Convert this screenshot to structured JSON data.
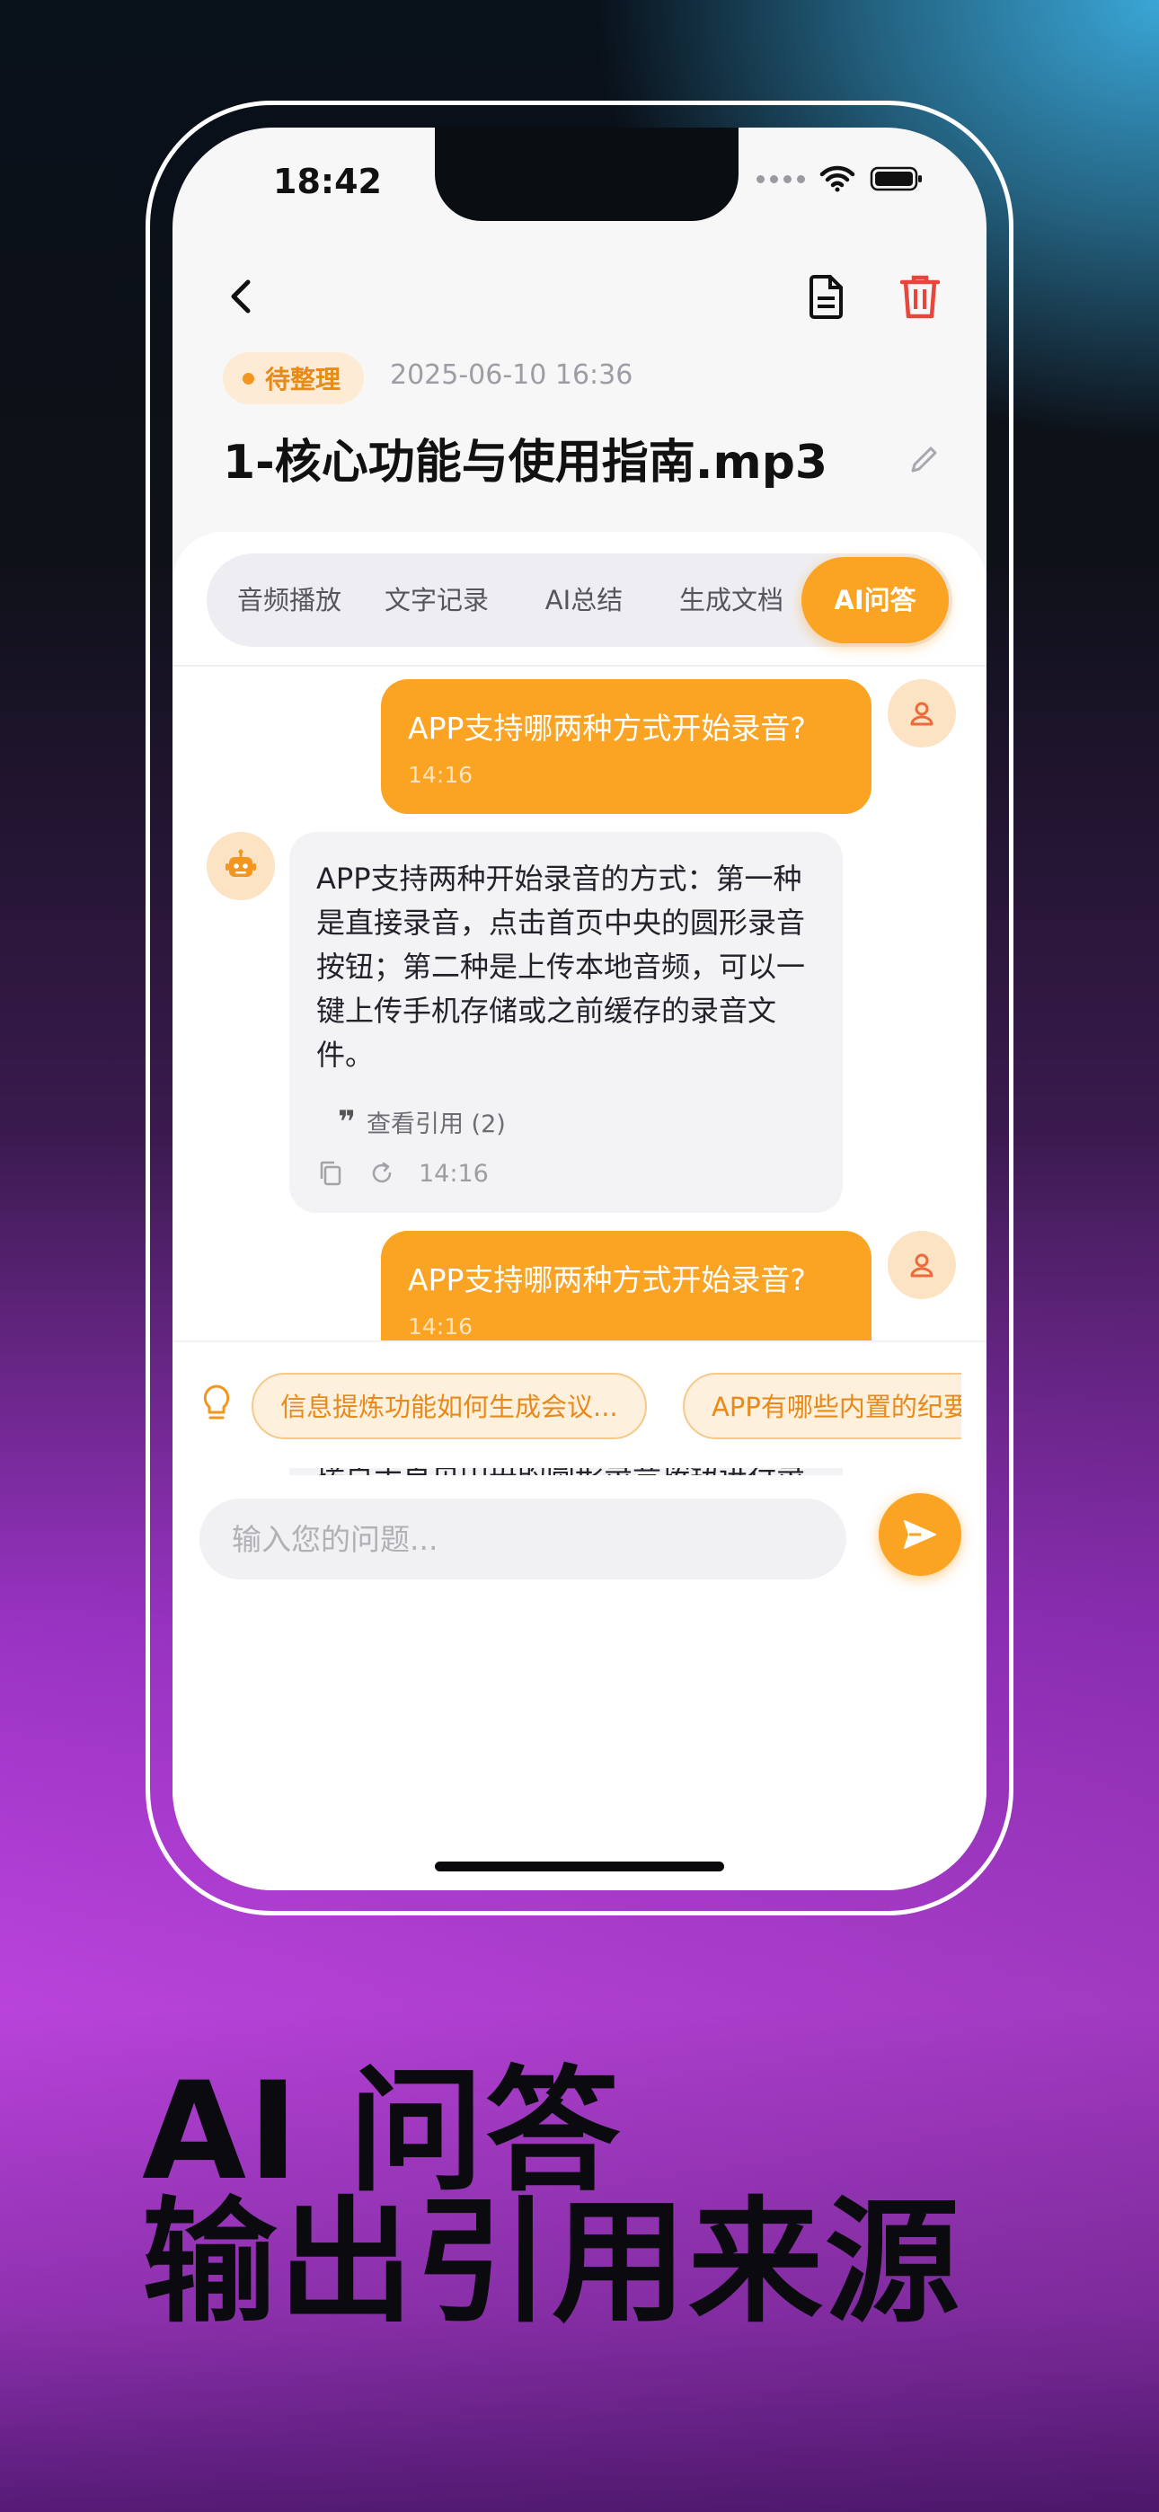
{
  "status_bar": {
    "time": "18:42"
  },
  "header": {
    "status_badge": "待整理",
    "date": "2025-06-10 16:36",
    "title": "1-核心功能与使用指南.mp3"
  },
  "tabs": [
    {
      "label": "音频播放",
      "active": false
    },
    {
      "label": "文字记录",
      "active": false
    },
    {
      "label": "AI总结",
      "active": false
    },
    {
      "label": "生成文档",
      "active": false
    },
    {
      "label": "AI问答",
      "active": true
    }
  ],
  "messages": [
    {
      "role": "user",
      "text": "APP支持哪两种方式开始录音?",
      "time": "14:16"
    },
    {
      "role": "assistant",
      "text": "APP支持两种开始录音的方式：第一种是直接录音，点击首页中央的圆形录音按钮；第二种是上传本地音频，可以一键上传手机存储或之前缓存的录音文件。",
      "citation": "查看引用 (2)",
      "time": "14:16"
    },
    {
      "role": "user",
      "text": "APP支持哪两种方式开始录音?",
      "time": "14:16"
    },
    {
      "role": "assistant",
      "text": "APP支持两种开始录音的方式：一是直接点击首页中央的圆形录音按钮进行录制；二是上传本地音频文件，包括手机存储中的文件或之前缓存的录音。"
    }
  ],
  "suggestions": [
    "信息提炼功能如何生成会议...",
    "APP有哪些内置的纪要"
  ],
  "input": {
    "placeholder": "输入您的问题..."
  },
  "marketing": {
    "line1": "AI 问答",
    "line2": "输出引用来源"
  },
  "colors": {
    "accent": "#fba323",
    "danger": "#e8453c",
    "badge_bg": "#fdebd6"
  }
}
